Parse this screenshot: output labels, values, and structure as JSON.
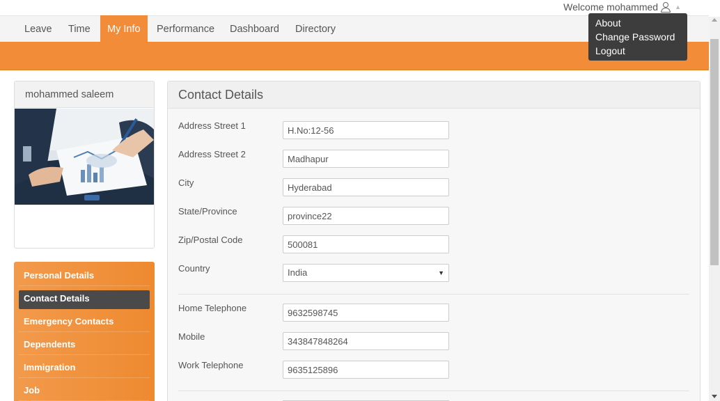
{
  "header": {
    "welcome_text": "Welcome mohammed",
    "user_menu": [
      "About",
      "Change Password",
      "Logout"
    ]
  },
  "nav": {
    "tabs": [
      "Leave",
      "Time",
      "My Info",
      "Performance",
      "Dashboard",
      "Directory"
    ],
    "active_tab": "My Info"
  },
  "profile": {
    "name": "mohammed saleem"
  },
  "side_menu": {
    "items": [
      "Personal Details",
      "Contact Details",
      "Emergency Contacts",
      "Dependents",
      "Immigration",
      "Job"
    ],
    "active_item": "Contact Details"
  },
  "contact_details": {
    "title": "Contact Details",
    "address_street_1": {
      "label": "Address Street 1",
      "value": "H.No:12-56"
    },
    "address_street_2": {
      "label": "Address Street 2",
      "value": "Madhapur"
    },
    "city": {
      "label": "City",
      "value": "Hyderabad"
    },
    "state_province": {
      "label": "State/Province",
      "value": "province22"
    },
    "zip_postal_code": {
      "label": "Zip/Postal Code",
      "value": "500081"
    },
    "country": {
      "label": "Country",
      "value": "India"
    },
    "home_telephone": {
      "label": "Home Telephone",
      "value": "9632598745"
    },
    "mobile": {
      "label": "Mobile",
      "value": "343847848264"
    },
    "work_telephone": {
      "label": "Work Telephone",
      "value": "9635125896"
    }
  },
  "colors": {
    "accent": "#f28c38",
    "dark": "#3d3d3d"
  },
  "icons": {
    "user": "user-icon",
    "dropdown_caret": "caret-icon",
    "select_arrow": "chevron-down-icon"
  }
}
